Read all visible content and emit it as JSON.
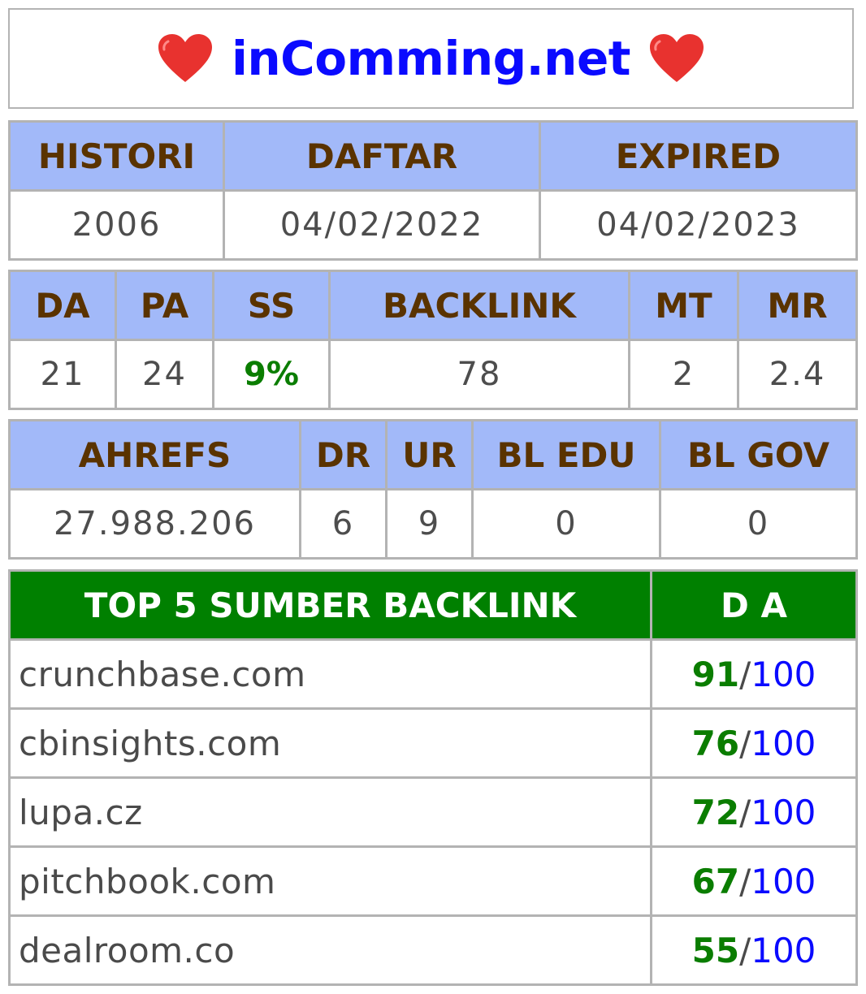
{
  "title": {
    "text": "inComming.net",
    "heart_icon": "heart-icon",
    "heart_color": "#e8322f",
    "text_color": "#0a0aff"
  },
  "dates_table": {
    "headers": [
      "HISTORI",
      "DAFTAR",
      "EXPIRED"
    ],
    "values": [
      "2006",
      "04/02/2022",
      "04/02/2023"
    ]
  },
  "moz_table": {
    "headers": [
      "DA",
      "PA",
      "SS",
      "BACKLINK",
      "MT",
      "MR"
    ],
    "values": [
      "21",
      "24",
      "9%",
      "78",
      "2",
      "2.4"
    ]
  },
  "ahrefs_table": {
    "headers": [
      "AHREFS",
      "DR",
      "UR",
      "BL EDU",
      "BL GOV"
    ],
    "values": [
      "27.988.206",
      "6",
      "9",
      "0",
      "0"
    ]
  },
  "backlinks_table": {
    "header_source": "TOP 5 SUMBER BACKLINK",
    "header_da": "D A",
    "max_label": "100",
    "separator": "/",
    "rows": [
      {
        "source": "crunchbase.com",
        "da": "91"
      },
      {
        "source": "cbinsights.com",
        "da": "76"
      },
      {
        "source": "lupa.cz",
        "da": "72"
      },
      {
        "source": "pitchbook.com",
        "da": "67"
      },
      {
        "source": "dealroom.co",
        "da": "55"
      }
    ]
  },
  "colors": {
    "header_bg": "#a2b9f9",
    "header_text": "#5a3300",
    "green": "#008000",
    "value_green": "#0a7d00",
    "blue": "#0a0aff",
    "border": "#b3b3b3"
  }
}
